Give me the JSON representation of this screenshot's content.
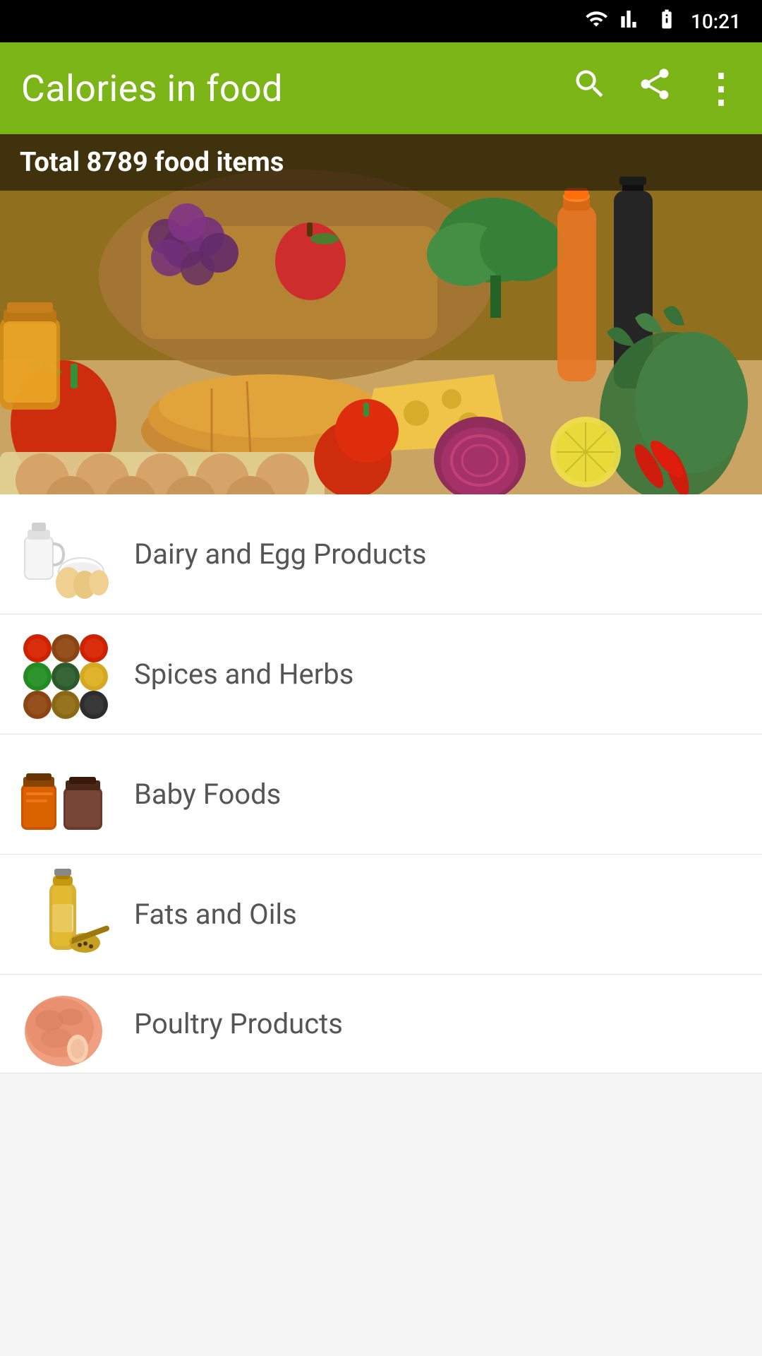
{
  "statusBar": {
    "time": "10:21"
  },
  "toolbar": {
    "title": "Calories in food",
    "searchLabel": "🔍",
    "shareLabel": "⋈",
    "menuLabel": "⋮"
  },
  "hero": {
    "totalText": "Total 8789 food items"
  },
  "categories": [
    {
      "id": "dairy",
      "name": "Dairy and Egg Products",
      "iconType": "dairy"
    },
    {
      "id": "spices",
      "name": "Spices and Herbs",
      "iconType": "spices"
    },
    {
      "id": "baby",
      "name": "Baby Foods",
      "iconType": "baby"
    },
    {
      "id": "fats",
      "name": "Fats and Oils",
      "iconType": "fats"
    },
    {
      "id": "poultry",
      "name": "Poultry Products",
      "iconType": "poultry"
    }
  ]
}
